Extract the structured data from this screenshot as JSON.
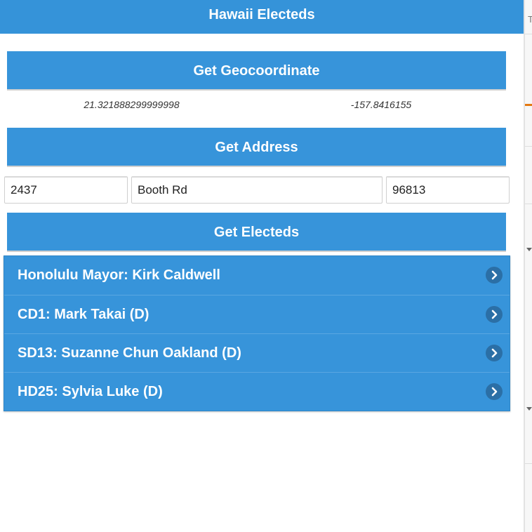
{
  "header": {
    "title": "Hawaii Electeds"
  },
  "buttons": {
    "geocoordinate": "Get Geocoordinate",
    "address": "Get Address",
    "electeds": "Get Electeds"
  },
  "coordinates": {
    "latitude": "21.321888299999998",
    "longitude": "-157.8416155"
  },
  "address": {
    "number": "2437",
    "street": "Booth Rd",
    "zip": "96813"
  },
  "electeds": [
    {
      "label": "Honolulu Mayor: Kirk Caldwell"
    },
    {
      "label": "CD1: Mark Takai (D)"
    },
    {
      "label": "SD13: Suzanne Chun Oakland (D)"
    },
    {
      "label": "HD25: Sylvia Luke (D)"
    }
  ],
  "background_page": {
    "tab_fragment": "T"
  },
  "colors": {
    "accent": "#3794da",
    "header": "#3593d9",
    "chevron_bg": "#2b6fa6"
  },
  "icons": {
    "list_item_arrow": "chevron-right-icon"
  }
}
